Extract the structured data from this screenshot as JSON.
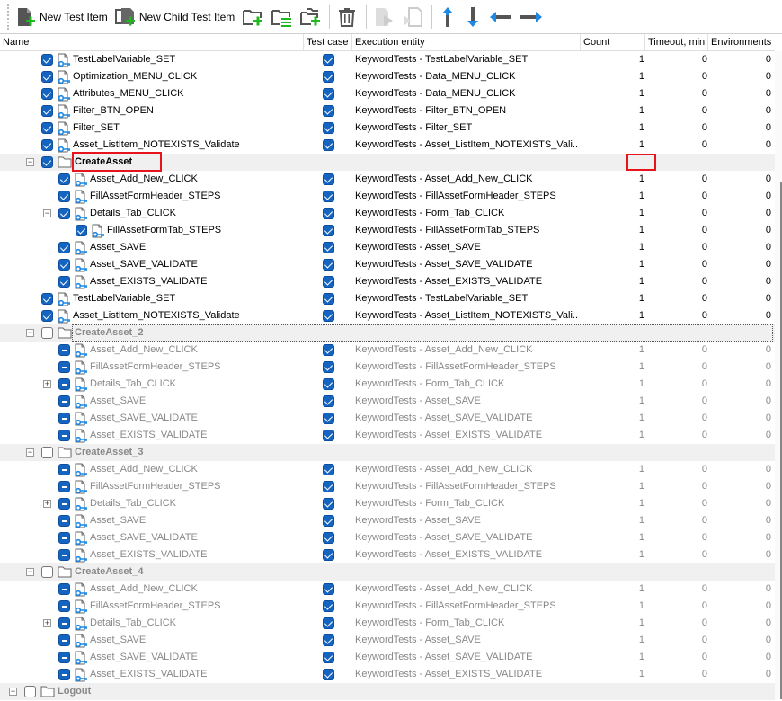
{
  "toolbar": {
    "new_test_item": "New Test Item",
    "new_child_test_item": "New Child Test Item",
    "icons": [
      "new-test-item-icon",
      "new-child-test-item-icon",
      "add-folder-icon",
      "folder-list-icon",
      "add-child-folder-icon",
      "delete-icon",
      "run-disabled-icon",
      "run-selected-disabled-icon",
      "move-up-icon",
      "move-down-icon",
      "move-left-icon",
      "move-right-icon"
    ]
  },
  "columns": [
    "Name",
    "Test case",
    "Execution entity",
    "Count",
    "Timeout, min",
    "Environments"
  ],
  "colors": {
    "accent": "#1565c0",
    "highlight": "#e8141c",
    "green": "#1fb81f",
    "arrow": "#1e88e5"
  },
  "rows": [
    {
      "lv": 1,
      "cb": "on",
      "icon": "test",
      "name": "TestLabelVariable_SET",
      "tc": true,
      "ent": "KeywordTests - TestLabelVariable_SET",
      "c": "1",
      "t": "0",
      "e": "0"
    },
    {
      "lv": 1,
      "cb": "on",
      "icon": "test",
      "name": "Optimization_MENU_CLICK",
      "tc": true,
      "ent": "KeywordTests - Data_MENU_CLICK",
      "c": "1",
      "t": "0",
      "e": "0"
    },
    {
      "lv": 1,
      "cb": "on",
      "icon": "test",
      "name": "Attributes_MENU_CLICK",
      "tc": true,
      "ent": "KeywordTests - Data_MENU_CLICK",
      "c": "1",
      "t": "0",
      "e": "0"
    },
    {
      "lv": 1,
      "cb": "on",
      "icon": "test",
      "name": "Filter_BTN_OPEN",
      "tc": true,
      "ent": "KeywordTests - Filter_BTN_OPEN",
      "c": "1",
      "t": "0",
      "e": "0"
    },
    {
      "lv": 1,
      "cb": "on",
      "icon": "test",
      "name": "Filter_SET",
      "tc": true,
      "ent": "KeywordTests - Filter_SET",
      "c": "1",
      "t": "0",
      "e": "0"
    },
    {
      "lv": 1,
      "cb": "on",
      "icon": "test",
      "name": "Asset_ListItem_NOTEXISTS_Validate",
      "tc": true,
      "ent": "KeywordTests - Asset_ListItem_NOTEXISTS_Vali...",
      "c": "1",
      "t": "0",
      "e": "0"
    },
    {
      "lv": 1,
      "cb": "on",
      "icon": "folder",
      "name": "CreateAsset",
      "exp": "-",
      "grp": true,
      "bold": true
    },
    {
      "lv": 2,
      "cb": "on",
      "icon": "test",
      "name": "Asset_Add_New_CLICK",
      "tc": true,
      "ent": "KeywordTests - Asset_Add_New_CLICK",
      "c": "1",
      "t": "0",
      "e": "0"
    },
    {
      "lv": 2,
      "cb": "on",
      "icon": "test",
      "name": "FillAssetFormHeader_STEPS",
      "tc": true,
      "ent": "KeywordTests - FillAssetFormHeader_STEPS",
      "c": "1",
      "t": "0",
      "e": "0"
    },
    {
      "lv": 2,
      "cb": "on",
      "icon": "test",
      "name": "Details_Tab_CLICK",
      "exp": "-",
      "tc": true,
      "ent": "KeywordTests - Form_Tab_CLICK",
      "c": "1",
      "t": "0",
      "e": "0"
    },
    {
      "lv": 3,
      "cb": "on",
      "icon": "test",
      "name": "FillAssetFormTab_STEPS",
      "tc": true,
      "ent": "KeywordTests - FillAssetFormTab_STEPS",
      "c": "1",
      "t": "0",
      "e": "0"
    },
    {
      "lv": 2,
      "cb": "on",
      "icon": "test",
      "name": "Asset_SAVE",
      "tc": true,
      "ent": "KeywordTests - Asset_SAVE",
      "c": "1",
      "t": "0",
      "e": "0"
    },
    {
      "lv": 2,
      "cb": "on",
      "icon": "test",
      "name": "Asset_SAVE_VALIDATE",
      "tc": true,
      "ent": "KeywordTests - Asset_SAVE_VALIDATE",
      "c": "1",
      "t": "0",
      "e": "0"
    },
    {
      "lv": 2,
      "cb": "on",
      "icon": "test",
      "name": "Asset_EXISTS_VALIDATE",
      "tc": true,
      "ent": "KeywordTests - Asset_EXISTS_VALIDATE",
      "c": "1",
      "t": "0",
      "e": "0"
    },
    {
      "lv": 1,
      "cb": "on",
      "icon": "test",
      "name": "TestLabelVariable_SET",
      "tc": true,
      "ent": "KeywordTests - TestLabelVariable_SET",
      "c": "1",
      "t": "0",
      "e": "0"
    },
    {
      "lv": 1,
      "cb": "on",
      "icon": "test",
      "name": "Asset_ListItem_NOTEXISTS_Validate",
      "tc": true,
      "ent": "KeywordTests - Asset_ListItem_NOTEXISTS_Vali...",
      "c": "1",
      "t": "0",
      "e": "0"
    },
    {
      "lv": 1,
      "cb": "off",
      "icon": "folder",
      "name": "CreateAsset_2",
      "exp": "-",
      "grp": true,
      "bold": true,
      "dis": true,
      "focus": true
    },
    {
      "lv": 2,
      "cb": "ind",
      "icon": "test",
      "name": "Asset_Add_New_CLICK",
      "tc": true,
      "ent": "KeywordTests - Asset_Add_New_CLICK",
      "c": "1",
      "t": "0",
      "e": "0",
      "dis": true
    },
    {
      "lv": 2,
      "cb": "ind",
      "icon": "test",
      "name": "FillAssetFormHeader_STEPS",
      "tc": true,
      "ent": "KeywordTests - FillAssetFormHeader_STEPS",
      "c": "1",
      "t": "0",
      "e": "0",
      "dis": true
    },
    {
      "lv": 2,
      "cb": "ind",
      "icon": "test",
      "name": "Details_Tab_CLICK",
      "exp": "+",
      "tc": true,
      "ent": "KeywordTests - Form_Tab_CLICK",
      "c": "1",
      "t": "0",
      "e": "0",
      "dis": true
    },
    {
      "lv": 2,
      "cb": "ind",
      "icon": "test",
      "name": "Asset_SAVE",
      "tc": true,
      "ent": "KeywordTests - Asset_SAVE",
      "c": "1",
      "t": "0",
      "e": "0",
      "dis": true
    },
    {
      "lv": 2,
      "cb": "ind",
      "icon": "test",
      "name": "Asset_SAVE_VALIDATE",
      "tc": true,
      "ent": "KeywordTests - Asset_SAVE_VALIDATE",
      "c": "1",
      "t": "0",
      "e": "0",
      "dis": true
    },
    {
      "lv": 2,
      "cb": "ind",
      "icon": "test",
      "name": "Asset_EXISTS_VALIDATE",
      "tc": true,
      "ent": "KeywordTests - Asset_EXISTS_VALIDATE",
      "c": "1",
      "t": "0",
      "e": "0",
      "dis": true
    },
    {
      "lv": 1,
      "cb": "off",
      "icon": "folder",
      "name": "CreateAsset_3",
      "exp": "-",
      "grp": true,
      "bold": true,
      "dis": true
    },
    {
      "lv": 2,
      "cb": "ind",
      "icon": "test",
      "name": "Asset_Add_New_CLICK",
      "tc": true,
      "ent": "KeywordTests - Asset_Add_New_CLICK",
      "c": "1",
      "t": "0",
      "e": "0",
      "dis": true
    },
    {
      "lv": 2,
      "cb": "ind",
      "icon": "test",
      "name": "FillAssetFormHeader_STEPS",
      "tc": true,
      "ent": "KeywordTests - FillAssetFormHeader_STEPS",
      "c": "1",
      "t": "0",
      "e": "0",
      "dis": true
    },
    {
      "lv": 2,
      "cb": "ind",
      "icon": "test",
      "name": "Details_Tab_CLICK",
      "exp": "+",
      "tc": true,
      "ent": "KeywordTests - Form_Tab_CLICK",
      "c": "1",
      "t": "0",
      "e": "0",
      "dis": true
    },
    {
      "lv": 2,
      "cb": "ind",
      "icon": "test",
      "name": "Asset_SAVE",
      "tc": true,
      "ent": "KeywordTests - Asset_SAVE",
      "c": "1",
      "t": "0",
      "e": "0",
      "dis": true
    },
    {
      "lv": 2,
      "cb": "ind",
      "icon": "test",
      "name": "Asset_SAVE_VALIDATE",
      "tc": true,
      "ent": "KeywordTests - Asset_SAVE_VALIDATE",
      "c": "1",
      "t": "0",
      "e": "0",
      "dis": true
    },
    {
      "lv": 2,
      "cb": "ind",
      "icon": "test",
      "name": "Asset_EXISTS_VALIDATE",
      "tc": true,
      "ent": "KeywordTests - Asset_EXISTS_VALIDATE",
      "c": "1",
      "t": "0",
      "e": "0",
      "dis": true
    },
    {
      "lv": 1,
      "cb": "off",
      "icon": "folder",
      "name": "CreateAsset_4",
      "exp": "-",
      "grp": true,
      "bold": true,
      "dis": true
    },
    {
      "lv": 2,
      "cb": "ind",
      "icon": "test",
      "name": "Asset_Add_New_CLICK",
      "tc": true,
      "ent": "KeywordTests - Asset_Add_New_CLICK",
      "c": "1",
      "t": "0",
      "e": "0",
      "dis": true
    },
    {
      "lv": 2,
      "cb": "ind",
      "icon": "test",
      "name": "FillAssetFormHeader_STEPS",
      "tc": true,
      "ent": "KeywordTests - FillAssetFormHeader_STEPS",
      "c": "1",
      "t": "0",
      "e": "0",
      "dis": true
    },
    {
      "lv": 2,
      "cb": "ind",
      "icon": "test",
      "name": "Details_Tab_CLICK",
      "exp": "+",
      "tc": true,
      "ent": "KeywordTests - Form_Tab_CLICK",
      "c": "1",
      "t": "0",
      "e": "0",
      "dis": true
    },
    {
      "lv": 2,
      "cb": "ind",
      "icon": "test",
      "name": "Asset_SAVE",
      "tc": true,
      "ent": "KeywordTests - Asset_SAVE",
      "c": "1",
      "t": "0",
      "e": "0",
      "dis": true
    },
    {
      "lv": 2,
      "cb": "ind",
      "icon": "test",
      "name": "Asset_SAVE_VALIDATE",
      "tc": true,
      "ent": "KeywordTests - Asset_SAVE_VALIDATE",
      "c": "1",
      "t": "0",
      "e": "0",
      "dis": true
    },
    {
      "lv": 2,
      "cb": "ind",
      "icon": "test",
      "name": "Asset_EXISTS_VALIDATE",
      "tc": true,
      "ent": "KeywordTests - Asset_EXISTS_VALIDATE",
      "c": "1",
      "t": "0",
      "e": "0",
      "dis": true
    },
    {
      "lv": 0,
      "cb": "off",
      "icon": "folder",
      "name": "Logout",
      "exp": "-",
      "grp": true,
      "bold": true,
      "dis": true
    }
  ]
}
